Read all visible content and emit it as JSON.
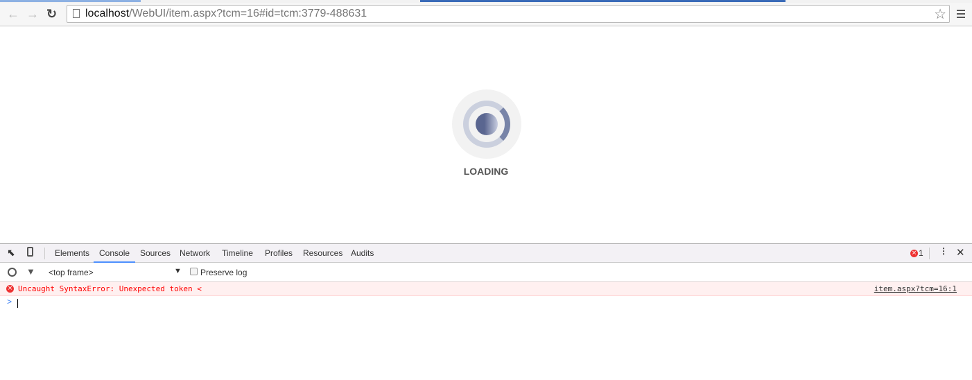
{
  "browser": {
    "url_host": "localhost",
    "url_path": "/WebUI/item.aspx?tcm=16#id=tcm:3779-488631"
  },
  "page": {
    "loading_text": "LOADING"
  },
  "devtools": {
    "tabs": [
      "Elements",
      "Console",
      "Sources",
      "Network",
      "Timeline",
      "Profiles",
      "Resources",
      "Audits"
    ],
    "active_tab": "Console",
    "error_count": "1",
    "frame_select": "<top frame>",
    "preserve_log_label": "Preserve log",
    "preserve_log_checked": false,
    "error_message": "Uncaught SyntaxError: Unexpected token <",
    "error_source": "item.aspx?tcm=16:1",
    "prompt": ">"
  },
  "colors": {
    "error": "#ff0000",
    "accent": "#4d90fe"
  }
}
